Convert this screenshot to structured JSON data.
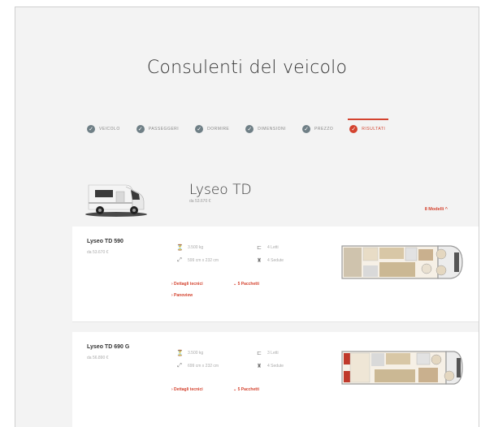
{
  "header": {
    "title": "Consulenti del veicolo"
  },
  "steps": [
    {
      "label": "Veicolo",
      "icon": "check",
      "active": false
    },
    {
      "label": "Passeggeri",
      "icon": "check",
      "active": false
    },
    {
      "label": "Dormire",
      "icon": "check",
      "active": false
    },
    {
      "label": "Dimensioni",
      "icon": "check",
      "active": false
    },
    {
      "label": "Prezzo",
      "icon": "check",
      "active": false
    },
    {
      "label": "Risultati",
      "icon": "check",
      "active": true
    }
  ],
  "vehicle": {
    "name": "Lyseo TD",
    "price": "da 53.670 €",
    "models_toggle": "8 Modelli ^"
  },
  "models": [
    {
      "name": "Lyseo TD 590",
      "price": "da 53.670 €",
      "weight": "3.500 kg",
      "beds": "4 Letti",
      "dimensions": "599 cm x 232 cm",
      "seats": "4 Sedute",
      "link_tech": "› Dettagli tecnici",
      "link_packages": "⌄ 5 Pacchetti",
      "link_panoview": "› Panoview"
    },
    {
      "name": "Lyseo TD 690 G",
      "price": "da 56.890 €",
      "weight": "3.500 kg",
      "beds": "3 Letti",
      "dimensions": "699 cm x 232 cm",
      "seats": "4 Sedute",
      "link_tech": "› Dettagli tecnici",
      "link_packages": "⌄ 5 Pacchetti"
    }
  ],
  "colors": {
    "accent": "#d4432f",
    "step": "#6f7f86",
    "background": "#f3f3f3"
  },
  "icons": {
    "weight": "weight-icon",
    "beds": "bed-icon",
    "dimensions": "dimensions-icon",
    "seats": "seat-icon"
  }
}
